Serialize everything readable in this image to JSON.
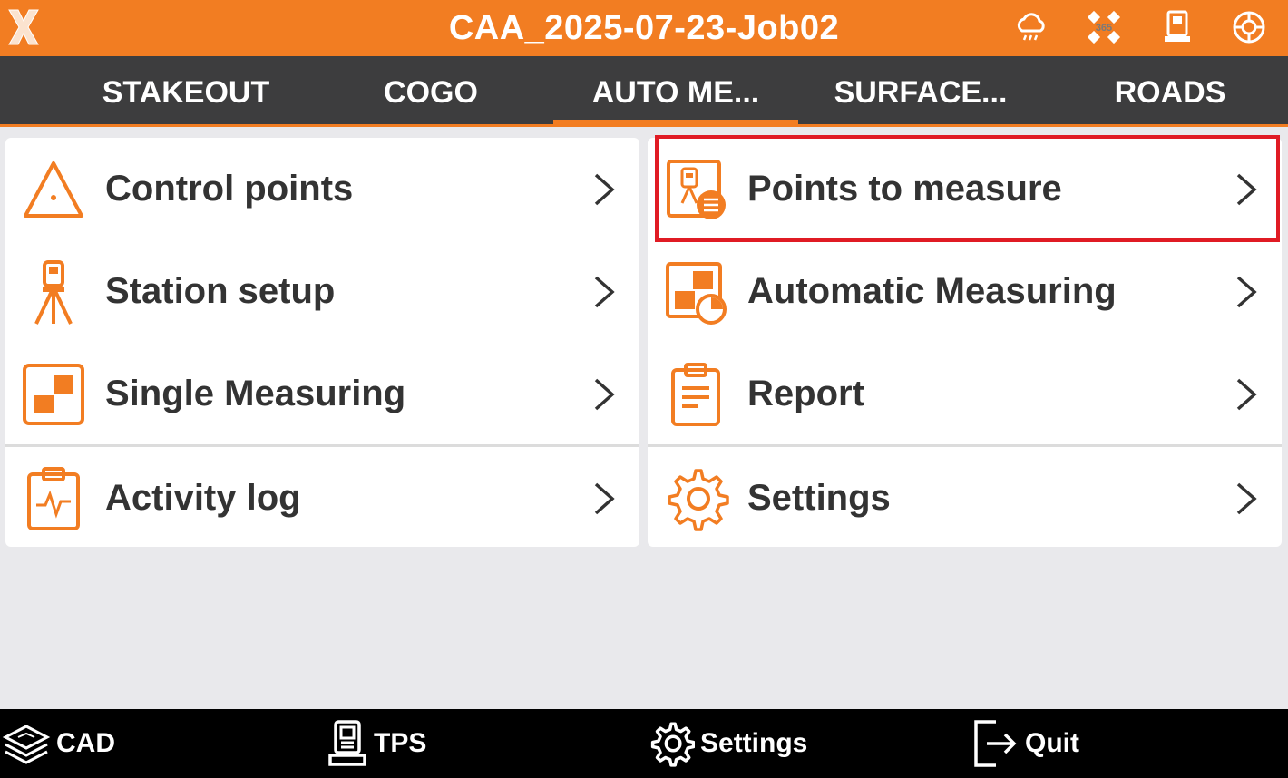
{
  "titlebar": {
    "title": "CAA_2025-07-23-Job02",
    "icons": [
      "app-logo-icon",
      "weather-cloud-icon",
      "satellite-365-icon",
      "total-station-icon",
      "help-lifebuoy-icon"
    ],
    "badge_365": "365"
  },
  "tabs": [
    {
      "label": "STAKEOUT",
      "active": false
    },
    {
      "label": "COGO",
      "active": false
    },
    {
      "label": "AUTO ME...",
      "active": true
    },
    {
      "label": "SURFACE...",
      "active": false
    },
    {
      "label": "ROADS",
      "active": false
    }
  ],
  "left_menu": [
    {
      "label": "Control points",
      "icon": "triangle-point-icon"
    },
    {
      "label": "Station setup",
      "icon": "tripod-instrument-icon"
    },
    {
      "label": "Single Measuring",
      "icon": "single-measure-icon"
    },
    {
      "label": "Activity log",
      "icon": "clipboard-pulse-icon"
    }
  ],
  "right_menu": [
    {
      "label": "Points to measure",
      "icon": "points-list-icon",
      "highlighted": true
    },
    {
      "label": "Automatic Measuring",
      "icon": "auto-measure-icon"
    },
    {
      "label": "Report",
      "icon": "report-clipboard-icon"
    },
    {
      "label": "Settings",
      "icon": "gear-icon"
    }
  ],
  "bottombar": [
    {
      "label": "CAD",
      "icon": "layers-icon"
    },
    {
      "label": "TPS",
      "icon": "total-station-icon"
    },
    {
      "label": "Settings",
      "icon": "gear-icon"
    },
    {
      "label": "Quit",
      "icon": "exit-icon"
    }
  ],
  "colors": {
    "accent": "#f27d22",
    "tabbar": "#3d3d3e",
    "highlight": "#e01b24",
    "text": "#333333"
  }
}
